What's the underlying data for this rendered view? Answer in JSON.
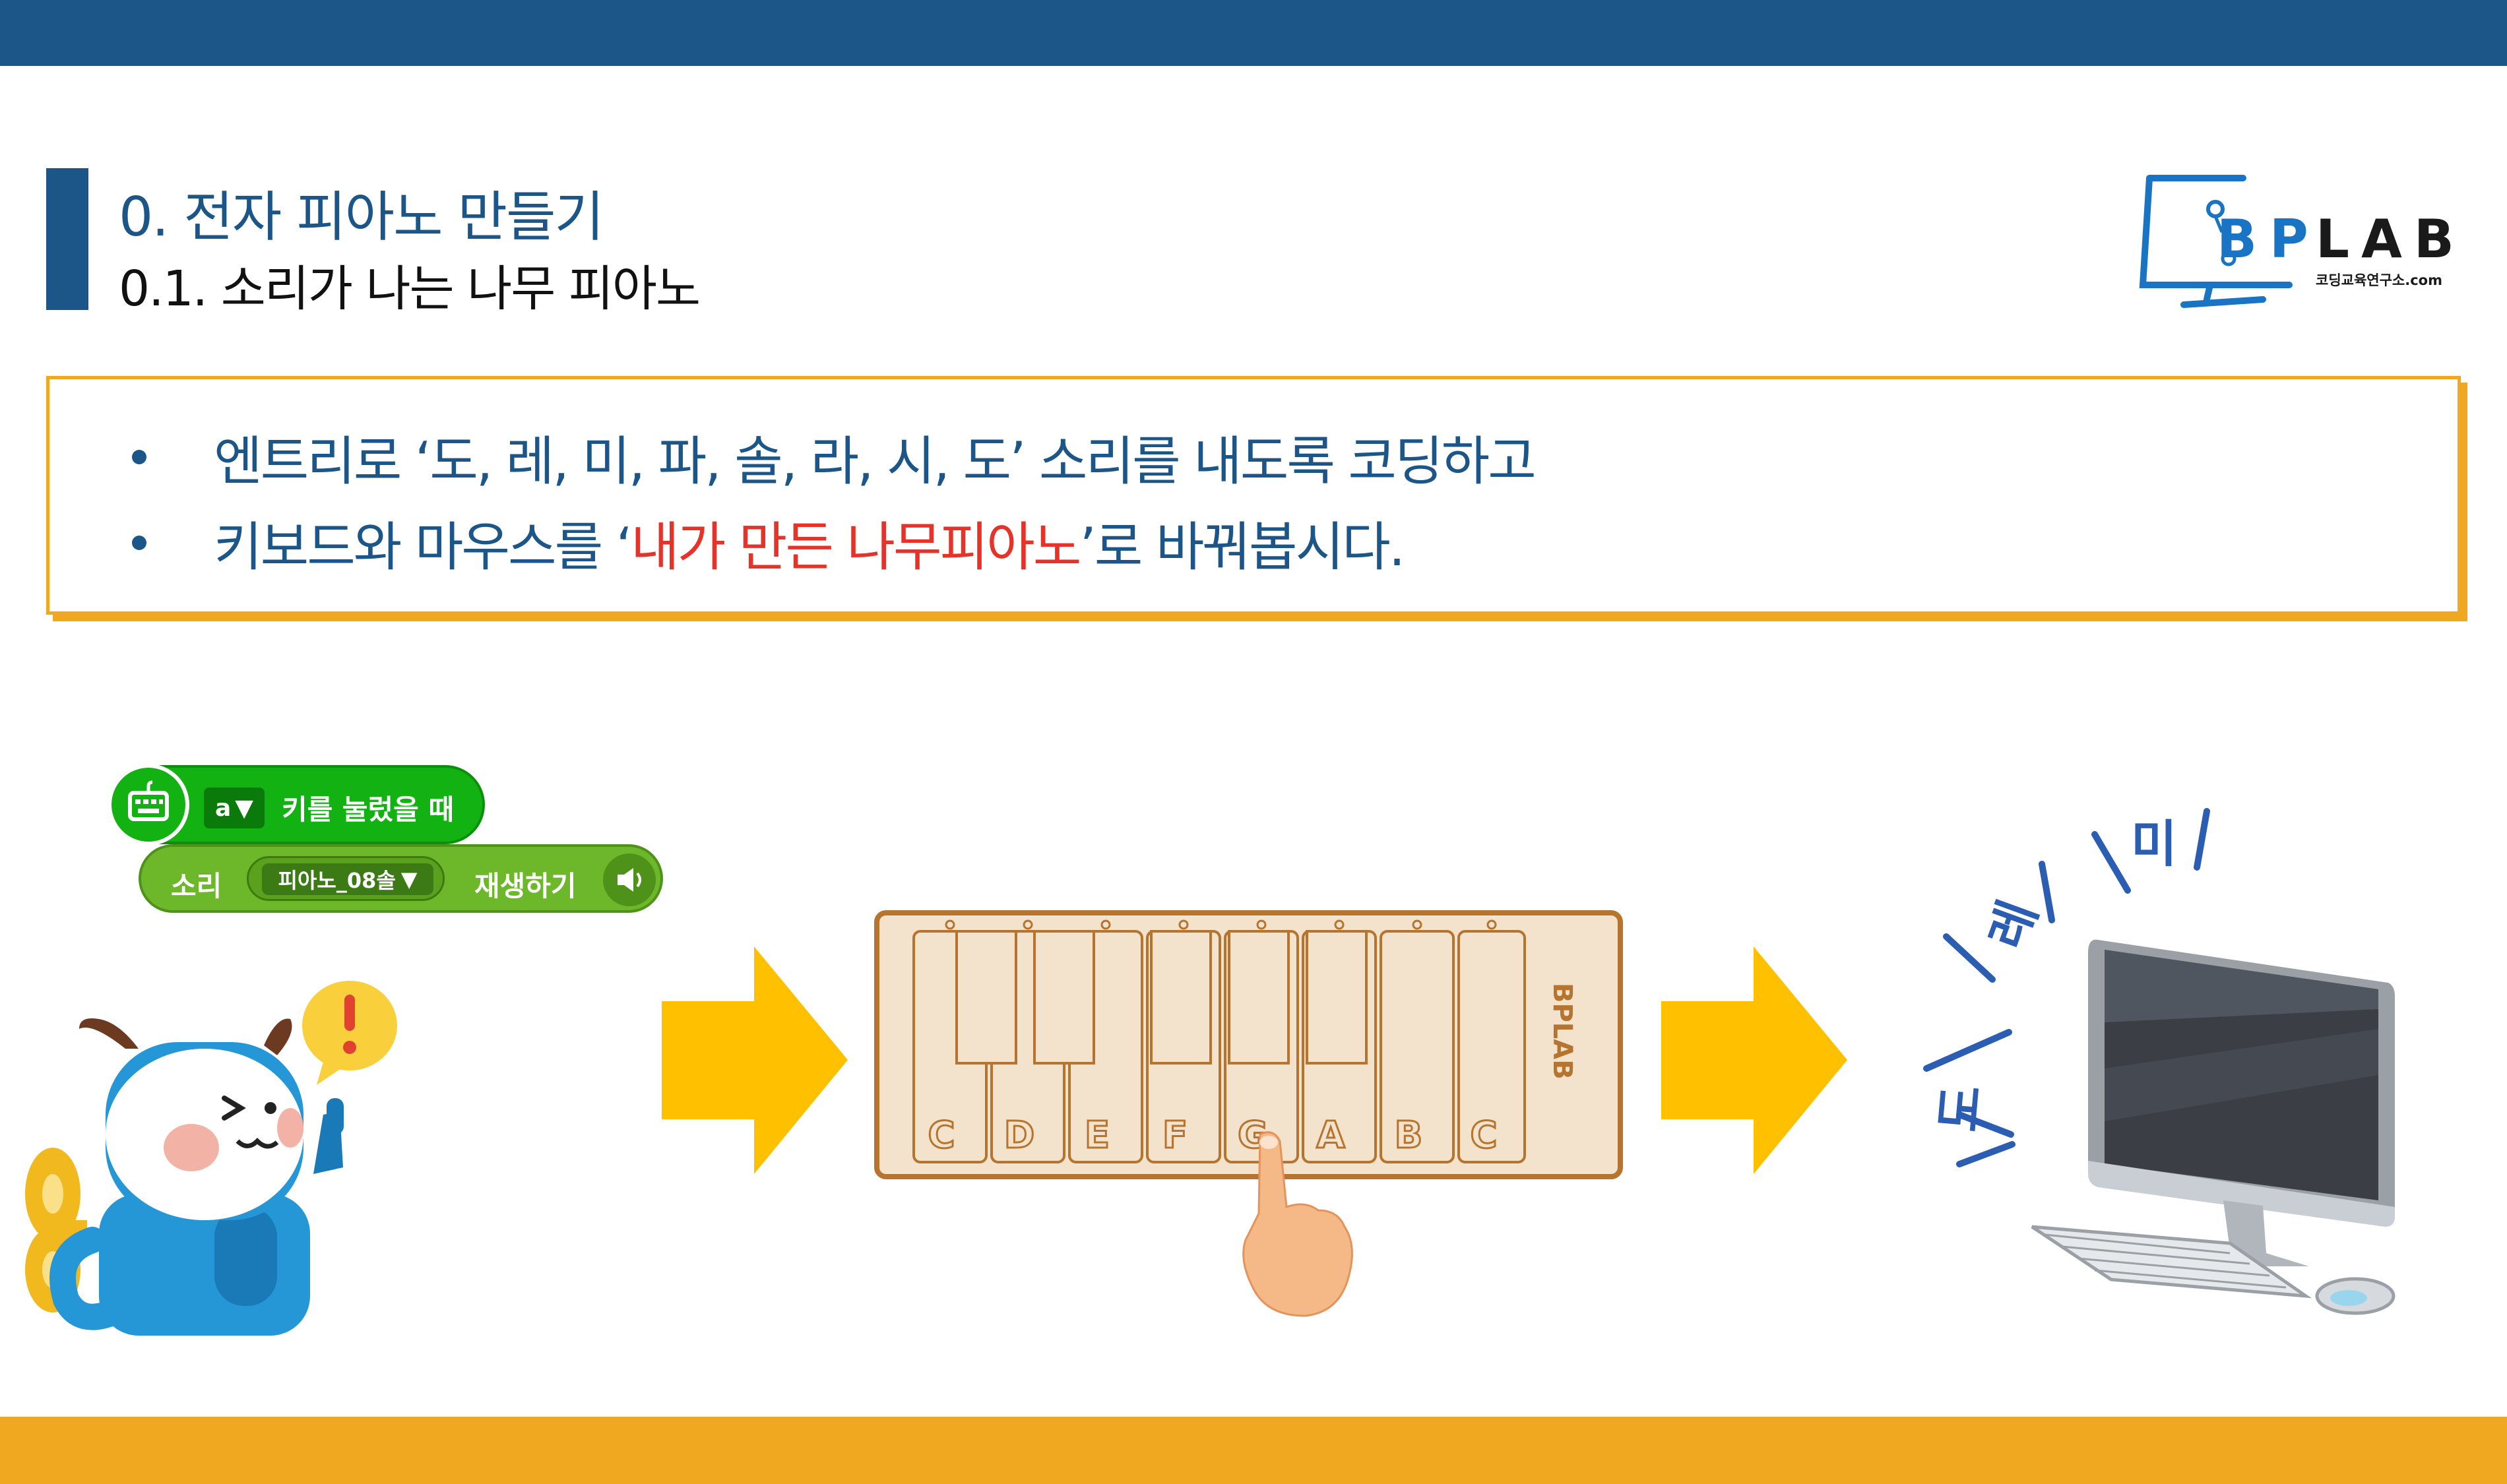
{
  "header": {
    "title": "0. 전자 피아노 만들기",
    "subtitle": "0.1. 소리가 나는 나무 피아노"
  },
  "logo": {
    "text_b": "B",
    "text_p": "P",
    "text_lab": "LAB",
    "tagline": "코딩교육연구소.com"
  },
  "bullets": [
    {
      "text": "엔트리로 ‘도, 레, 미, 파, 솔, 라, 시, 도’ 소리를 내도록 코딩하고"
    },
    {
      "prefix": "키보드와 마우스를 ‘",
      "highlight": "내가 만든 나무피아노",
      "suffix": "’로 바꿔봅시다."
    }
  ],
  "code": {
    "event_key": "a",
    "event_label": "키를 눌렀을 때",
    "sound_label": "소리",
    "sound_value": "피아노_08솔",
    "play_label": "재생하기"
  },
  "piano": {
    "keys": [
      "C",
      "D",
      "E",
      "F",
      "G",
      "A",
      "B",
      "C"
    ],
    "brand": "BPLAB"
  },
  "notes": {
    "do": "도",
    "re": "레",
    "mi": "미"
  },
  "colors": {
    "primary": "#1c5588",
    "accent": "#f0a820",
    "highlight": "#e5332a",
    "arrow": "#ffc000",
    "note": "#2b5db2"
  },
  "icons": {
    "keyboard": "keyboard-icon",
    "speaker": "speaker-icon",
    "dropdown": "chevron-down-icon"
  }
}
